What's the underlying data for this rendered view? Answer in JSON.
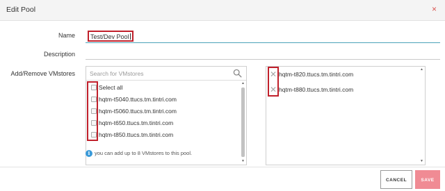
{
  "dialog": {
    "title": "Edit Pool",
    "close_glyph": "×"
  },
  "form": {
    "name_label": "Name",
    "name_value": "Test/Dev Pool",
    "description_label": "Description",
    "description_value": "",
    "vmstores_label": "Add/Remove VMstores"
  },
  "available": {
    "search_placeholder": "Search for VMstores",
    "select_all_label": "Select all",
    "items": [
      "hqtm-t5040.ttucs.tm.tintri.com",
      "hqtm-t5060.ttucs.tm.tintri.com",
      "hqtm-t650.ttucs.tm.tintri.com",
      "hqtm-t850.ttucs.tm.tintri.com"
    ]
  },
  "selected": {
    "items": [
      "hqtm-t820.ttucs.tm.tintri.com",
      "hqtm-t880.ttucs.tm.tintri.com"
    ]
  },
  "info": {
    "glyph": "i",
    "text": "you can add up to 8 VMstores to this pool."
  },
  "footer": {
    "cancel_label": "CANCEL",
    "save_label": "SAVE"
  },
  "colors": {
    "highlight": "#c0202b",
    "accent_line": "#4aa3b8",
    "save_button": "#f08b94",
    "info_icon": "#3a9ad9",
    "close_icon": "#d9534f"
  },
  "icons": {
    "close": "close-icon",
    "search": "search-icon",
    "remove": "remove-icon",
    "info": "info-icon"
  }
}
